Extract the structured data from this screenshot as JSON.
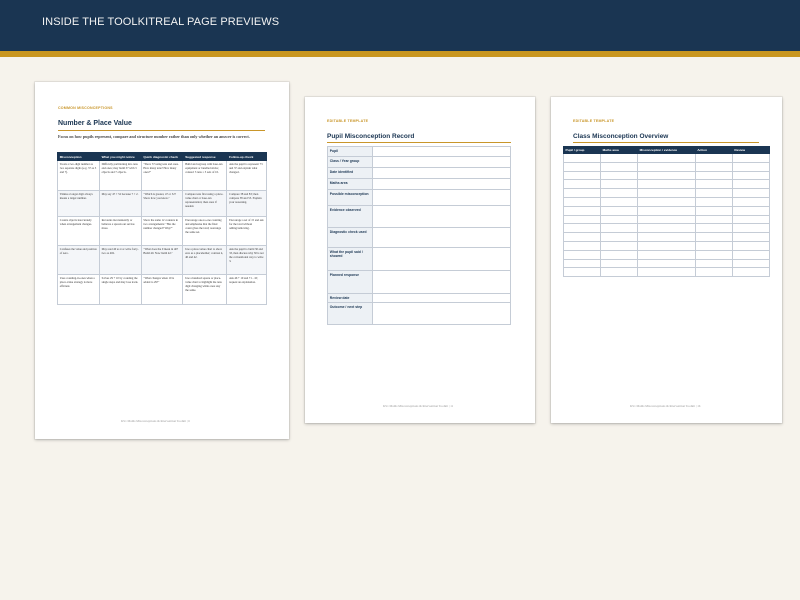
{
  "header": {
    "title": "INSIDE THE TOOLKIT\u0016REAL PAGE PREVIEWS",
    "colors": {
      "navy": "#1a3552",
      "gold": "#c9961f",
      "background": "#f6f3ec"
    }
  },
  "page1": {
    "kicker": "COMMON MISCONCEPTIONS",
    "title": "Number & Place Value",
    "intro": "Focus on how pupils represent, compare and structure number rather than only whether an answer is correct.",
    "table": {
      "headers": [
        "Misconception",
        "What you might notice",
        "Quick diagnostic check",
        "Suggested response",
        "Follow-up check"
      ],
      "rows": [
        [
          "Treats a two-digit number as two separate digits (e.g. 37 as 3 and 7).",
          "Difficulty partitioning into tens and ones; may build 37 with 3 objects and 7 objects.",
          "\"Show 37 using tens and ones. How many tens? How many ones?\"",
          "Build and regroup with base-ten equipment or bundled sticks; connect 3 tens = 3 sets of 10.",
          "Ask the pupil to represent 73 and 37 and explain what changed."
        ],
        [
          "Thinks a longer digit always means a larger number.",
          "May say 47 > 52 because 7 > 2.",
          "\"Which is greater, 47 or 52? Show how you know.\"",
          "Compare tens first using a place-value chart or base-ten representation; then ones if needed.",
          "Compare 38 and 83; then compare 58 and 55. Explain your reasoning."
        ],
        [
          "Counts objects inaccurately when arrangement changes.",
          "Recounts inconsistently or believes a spread-out set has more.",
          "Show the same 12 counters in two arrangements: \"Has the number changed? Why?\"",
          "Encourage one-to-one counting and emphasise that the final count gives the total; rearrange the same set.",
          "Encourage a set of 15 and ask for the total without adding/removing."
        ],
        [
          "Confuses the value and position of zero.",
          "May read 40 as 4 or write forty-two as 402.",
          "\"What does the 0 mean in 40? Build 40. Now build 42.\"",
          "Use a place-value chart to show zero as a placeholder; contrast 4, 40 and 42.",
          "Ask the pupil to build 30 and 33, then discuss why 30 is not the conventional way to write 3."
        ],
        [
          "Uses counting-in-ones when a place-value strategy is more efficient.",
          "Solves 29 + 10 by counting the single steps and may lose track.",
          "\"What changes when 10 is added to 29?\"",
          "Use a hundred square or place-value chart to highlight the tens digit changing while ones stay the same.",
          "Ask 46 + 10 and 71 - 10; request an explanation."
        ]
      ]
    },
    "footer": "KS1 Maths Misconceptions & Intervention Toolkit  |  6"
  },
  "page2": {
    "kicker": "EDITABLE TEMPLATE",
    "title": "Pupil Misconception Record",
    "fields": [
      "Pupil",
      "Class / Year group",
      "Date identified",
      "Maths area",
      "Possible misconception",
      "Evidence observed",
      "Diagnostic check used",
      "What the pupil said / showed",
      "Planned response",
      "Review date",
      "Outcome / next step"
    ],
    "footer": "KS1 Maths Misconceptions & Intervention Toolkit  |  11"
  },
  "page3": {
    "kicker": "EDITABLE TEMPLATE",
    "title": "Class Misconception Overview",
    "headers": [
      "Pupil / group",
      "Maths area",
      "Misconception / evidence",
      "Action",
      "Review"
    ],
    "footer": "KS1 Maths Misconceptions & Intervention Toolkit  |  16"
  }
}
